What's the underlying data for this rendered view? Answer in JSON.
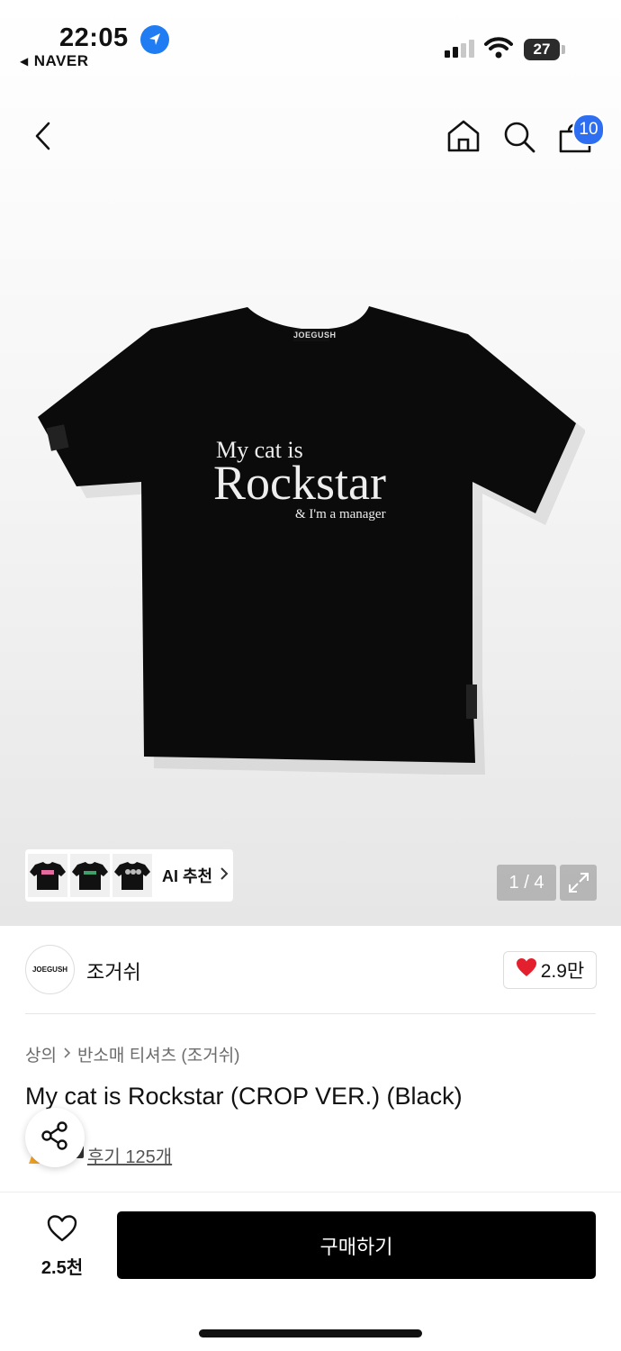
{
  "status_bar": {
    "time": "22:05",
    "back_app": "NAVER",
    "battery": "27"
  },
  "nav": {
    "cart_count": "10"
  },
  "hero": {
    "shirt_print": {
      "line1": "My cat is",
      "line2": "Rockstar",
      "line3": "& I'm a manager",
      "brand_tag": "JOEGUSH"
    },
    "recommendation_label": "AI 추천",
    "image_counter": "1 / 4"
  },
  "store": {
    "logo_text": "JOEGUSH",
    "name": "조거쉬",
    "likes": "2.9만"
  },
  "product": {
    "breadcrumb": [
      "상의",
      "반소매 티셔츠 (조거쉬)"
    ],
    "title": "My cat is Rockstar (CROP VER.) (Black)",
    "review_link": "후기 125개"
  },
  "bottom_bar": {
    "wish_count": "2.5천",
    "buy_label": "구매하기"
  },
  "colors": {
    "accent_blue": "#2e6ff2",
    "heart_red": "#e5202e",
    "buy_button": "#000000"
  }
}
